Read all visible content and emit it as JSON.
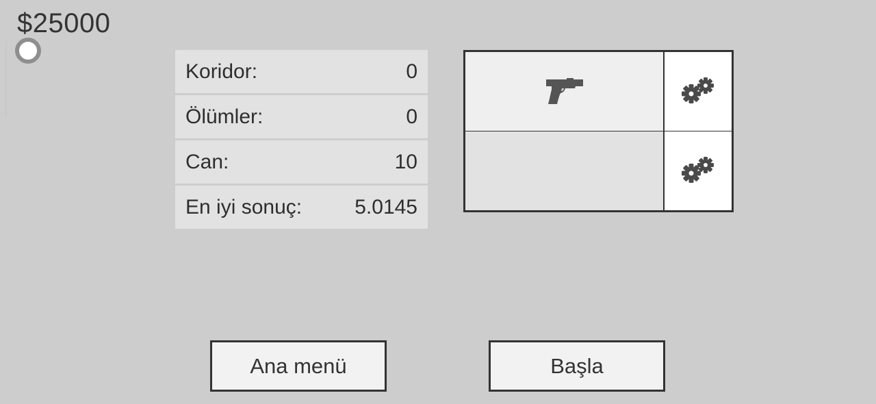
{
  "hud": {
    "money": "$25000"
  },
  "stats": [
    {
      "label": "Koridor:",
      "value": "0"
    },
    {
      "label": "Ölümler:",
      "value": "0"
    },
    {
      "label": "Can:",
      "value": "10"
    },
    {
      "label": "En iyi sonuç:",
      "value": "5.0145"
    }
  ],
  "weapons": {
    "primary_icon": "pistol-icon",
    "secondary_icon": null,
    "upgrade_icon": "gears-icon"
  },
  "buttons": {
    "main_menu": "Ana menü",
    "start": "Başla"
  },
  "colors": {
    "background": "#cdcdcd",
    "panel": "#e2e2e2",
    "border": "#333333",
    "icon": "#555555"
  }
}
